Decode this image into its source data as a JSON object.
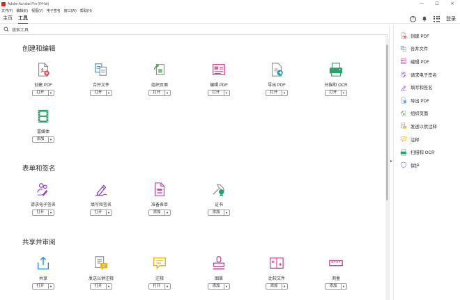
{
  "app": {
    "title": "Adobe Acrobat Pro (64-bit)"
  },
  "window_controls": {
    "minimize": "—",
    "maximize": "☐",
    "close": "✕"
  },
  "menu": [
    "文件(F)",
    "编辑(E)",
    "视图(V)",
    "电子签名",
    "窗口(W)",
    "帮助(H)"
  ],
  "tabs": {
    "home": "主页",
    "tools": "工具"
  },
  "header": {
    "help": "?",
    "login": "登录"
  },
  "search": {
    "placeholder": "搜索工具"
  },
  "sections": [
    {
      "title": "创建和编辑",
      "tools": [
        {
          "label": "创建 PDF",
          "action": "打开",
          "icon": "create-pdf-icon",
          "color": "#e34850"
        },
        {
          "label": "合并文件",
          "action": "打开",
          "icon": "combine-files-icon",
          "color": "#2d8ae0"
        },
        {
          "label": "组织页面",
          "action": "打开",
          "icon": "organize-pages-icon",
          "color": "#42a35a"
        },
        {
          "label": "编辑 PDF",
          "action": "打开",
          "icon": "edit-pdf-icon",
          "color": "#d63c8c"
        },
        {
          "label": "导出 PDF",
          "action": "打开",
          "icon": "export-pdf-icon",
          "color": "#1e9bb5"
        },
        {
          "label": "扫描和 OCR",
          "action": "打开",
          "icon": "scan-ocr-icon",
          "color": "#2ea06b"
        },
        {
          "label": "富媒体",
          "action": "添加",
          "icon": "rich-media-icon",
          "color": "#2ea06b"
        }
      ]
    },
    {
      "title": "表单和签名",
      "tools": [
        {
          "label": "请求电子签名",
          "action": "打开",
          "icon": "request-esign-icon",
          "color": "#9b3fc8"
        },
        {
          "label": "填写和签名",
          "action": "打开",
          "icon": "fill-sign-icon",
          "color": "#7b3fc8"
        },
        {
          "label": "准备表单",
          "action": "添加",
          "icon": "prepare-form-icon",
          "color": "#c83fa8"
        },
        {
          "label": "证书",
          "action": "添加",
          "icon": "certificate-icon",
          "color": "#2a9d72"
        }
      ]
    },
    {
      "title": "共享并审阅",
      "tools": [
        {
          "label": "共享",
          "action": "打开",
          "icon": "share-icon",
          "color": "#2d8ae0"
        },
        {
          "label": "发送以供注释",
          "action": "打开",
          "icon": "send-comment-icon",
          "color": "#e8b415"
        },
        {
          "label": "注释",
          "action": "打开",
          "icon": "comment-icon",
          "color": "#e8b415"
        },
        {
          "label": "图章",
          "action": "添加",
          "icon": "stamp-icon",
          "color": "#b5418a"
        },
        {
          "label": "比较文件",
          "action": "添加",
          "icon": "compare-files-icon",
          "color": "#c83f8c"
        },
        {
          "label": "测量",
          "action": "添加",
          "icon": "measure-icon",
          "color": "#c83f8c"
        }
      ]
    }
  ],
  "right_panel": [
    {
      "label": "创建 PDF",
      "icon": "create-pdf-icon",
      "color": "#e34850"
    },
    {
      "label": "合并文件",
      "icon": "combine-files-icon",
      "color": "#2d8ae0"
    },
    {
      "label": "编辑 PDF",
      "icon": "edit-pdf-icon",
      "color": "#d63c8c"
    },
    {
      "label": "请求电子签名",
      "icon": "request-esign-icon",
      "color": "#9b3fc8"
    },
    {
      "label": "填写和签名",
      "icon": "fill-sign-icon",
      "color": "#7b3fc8"
    },
    {
      "label": "导出 PDF",
      "icon": "export-pdf-icon",
      "color": "#1e9bb5"
    },
    {
      "label": "组织页面",
      "icon": "organize-pages-icon",
      "color": "#42a35a"
    },
    {
      "label": "发送以供注释",
      "icon": "send-comment-icon",
      "color": "#e8b415"
    },
    {
      "label": "注释",
      "icon": "comment-icon",
      "color": "#e8b415"
    },
    {
      "label": "扫描和 OCR",
      "icon": "scan-ocr-icon",
      "color": "#2ea06b"
    },
    {
      "label": "保护",
      "icon": "protect-icon",
      "color": "#5a6fc8"
    }
  ]
}
